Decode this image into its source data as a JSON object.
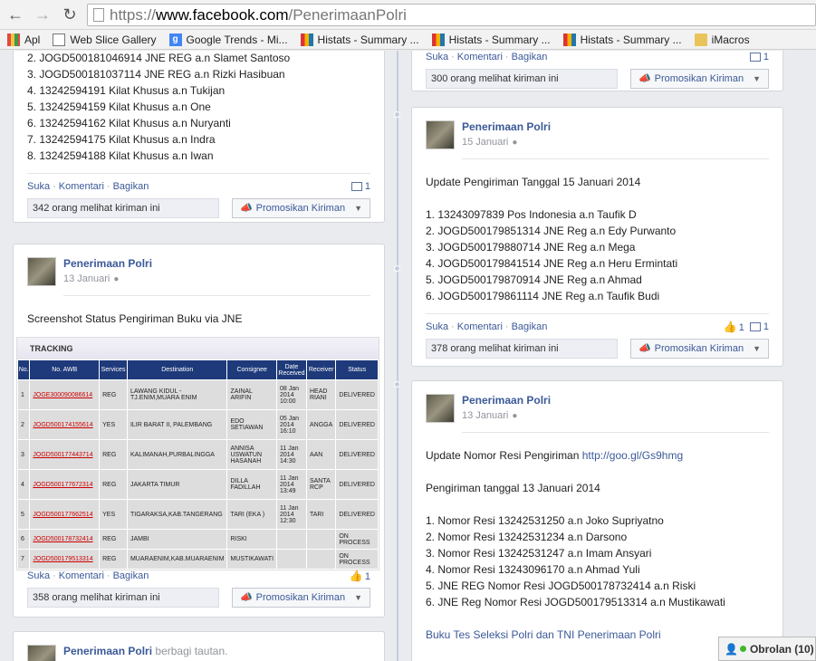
{
  "browser": {
    "url_scheme": "https://",
    "url_host": "www.facebook.com",
    "url_path": "/PenerimaanPolri",
    "bookmarks": [
      "Apl",
      "Web Slice Gallery",
      "Google Trends - Mi...",
      "Histats - Summary ...",
      "Histats - Summary ...",
      "Histats - Summary ...",
      "iMacros"
    ]
  },
  "post1": {
    "lines": [
      "2. JOGD500181046914 JNE REG a.n Slamet Santoso",
      "3. JOGD500181037114 JNE REG a.n Rizki Hasibuan",
      "4. 13242594191 Kilat Khusus a.n Tukijan",
      "5. 13242594159 Kilat Khusus a.n One",
      "6. 13242594162 Kilat Khusus a.n Nuryanti",
      "7. 13242594175 Kilat Khusus a.n Indra",
      "8. 13242594188 Kilat Khusus a.n Iwan"
    ],
    "comment_count": "1",
    "views": "342 orang melihat kiriman ini"
  },
  "actions": {
    "like": "Suka",
    "comment": "Komentari",
    "share": "Bagikan",
    "promote": "Promosikan Kiriman"
  },
  "post2": {
    "name": "Penerimaan Polri",
    "date": "13 Januari",
    "text": "Screenshot Status Pengiriman Buku via JNE",
    "like_count": "1",
    "views": "358 orang melihat kiriman ini",
    "tracking": {
      "title": "TRACKING",
      "headers": [
        "No.",
        "No. AWB",
        "Services",
        "Destination",
        "Consignee",
        "Date Received",
        "Receiver",
        "Status"
      ],
      "rows": [
        [
          "1",
          "JOGE300090086614",
          "REG",
          "LAWANG KIDUL - TJ.ENIM,MUARA ENIM",
          "ZAINAL ARIFIN",
          "08 Jan 2014 10:00",
          "HEAD RIANI",
          "DELIVERED"
        ],
        [
          "2",
          "JOGD500174155614",
          "YES",
          "ILIR BARAT II, PALEMBANG",
          "EDO SETIAWAN",
          "05 Jan 2014 16:10",
          "ANGGA",
          "DELIVERED"
        ],
        [
          "3",
          "JOGD500177443714",
          "REG",
          "KALIMANAH,PURBALINGGA",
          "ANNISA USWATUN HASANAH",
          "11 Jan 2014 14:30",
          "AAN",
          "DELIVERED"
        ],
        [
          "4",
          "JOGD500177672314",
          "REG",
          "JAKARTA TIMUR",
          "DILLA FADILLAH",
          "11 Jan 2014 13:49",
          "SANTA RCP",
          "DELIVERED"
        ],
        [
          "5",
          "JOGD500177662514",
          "YES",
          "TIGARAKSA,KAB.TANGERANG",
          "TARI (EKA )",
          "11 Jan 2014 12:30",
          "TARI",
          "DELIVERED"
        ],
        [
          "6",
          "JOGD500178732414",
          "REG",
          "JAMBI",
          "RISKI",
          "",
          "",
          "ON PROCESS"
        ],
        [
          "7",
          "JOGD500179513314",
          "REG",
          "MUARAENIM,KAB.MUARAENIM",
          "MUSTIKAWATI",
          "",
          "",
          "ON PROCESS"
        ]
      ]
    }
  },
  "post3": {
    "name": "Penerimaan Polri",
    "date_suffix": "berbagi tautan."
  },
  "post4": {
    "comment_count": "1",
    "views": "300 orang melihat kiriman ini"
  },
  "post5": {
    "name": "Penerimaan Polri",
    "date": "15 Januari",
    "heading": "Update Pengiriman Tanggal 15 Januari 2014",
    "lines": [
      "1. 13243097839 Pos Indonesia a.n Taufik D",
      "2. JOGD500179851314 JNE Reg a.n Edy Purwanto",
      "3. JOGD500179880714 JNE Reg a.n Mega",
      "4. JOGD500179841514 JNE Reg a.n Heru Ermintati",
      "5. JOGD500179870914 JNE Reg a.n Ahmad",
      "6. JOGD500179861114 JNE Reg a.n Taufik Budi"
    ],
    "like_count": "1",
    "comment_count": "1",
    "views": "378 orang melihat kiriman ini"
  },
  "post6": {
    "name": "Penerimaan Polri",
    "date": "13 Januari",
    "heading_prefix": "Update Nomor Resi Pengiriman ",
    "heading_link": "http://goo.gl/Gs9hmg",
    "subheading": "Pengiriman tanggal 13 Januari 2014",
    "lines": [
      "1. Nomor Resi 13242531250 a.n Joko Supriyatno",
      "2. Nomor Resi 13242531234 a.n Darsono",
      "3. Nomor Resi 13242531247 a.n Imam Ansyari",
      "4. Nomor Resi 13243096170 a.n Ahmad Yuli",
      "5. JNE REG Nomor Resi JOGD500178732414 a.n Riski",
      "6. JNE Reg Nomor Resi JOGD500179513314 a.n Mustikawati"
    ],
    "link_title": "Buku Tes Seleksi Polri dan TNI Penerimaan Polri"
  },
  "chat": {
    "label": "Obrolan (10)"
  }
}
